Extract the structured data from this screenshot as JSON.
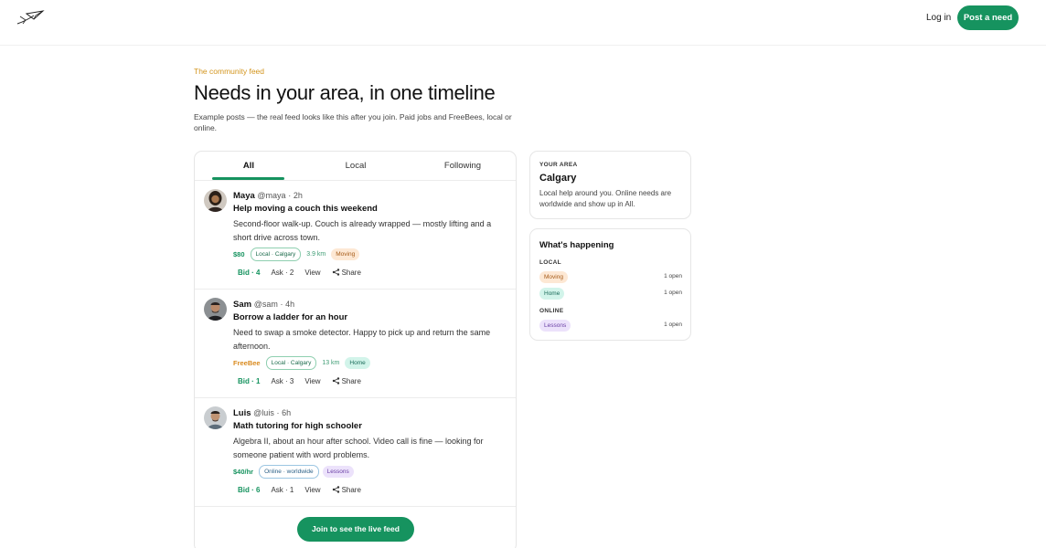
{
  "header": {
    "login_label": "Log in",
    "post_need_label": "Post a need",
    "accent": "#16935f"
  },
  "hero": {
    "eyebrow": "The community feed",
    "title": "Needs in your area, in one timeline",
    "intro": "Example posts — the real feed looks like this after you join. Paid jobs and FreeBees, local or online."
  },
  "feed": {
    "tabs": [
      {
        "label": "All",
        "active": true
      },
      {
        "label": "Local",
        "active": false
      },
      {
        "label": "Following",
        "active": false
      }
    ],
    "posts": [
      {
        "name": "Maya",
        "handle": "@maya",
        "time": "2h",
        "title": "Help moving a couch this weekend",
        "body": "Second-floor walk-up. Couch is already wrapped — mostly lifting and a short drive across town.",
        "price": "$80",
        "location": "Local · Calgary",
        "distance": "3.9 km",
        "category": "Moving",
        "bid": "Bid · 4",
        "ask": "Ask · 2",
        "view": "View",
        "share": "Share"
      },
      {
        "name": "Sam",
        "handle": "@sam",
        "time": "4h",
        "title": "Borrow a ladder for an hour",
        "body": "Need to swap a smoke detector. Happy to pick up and return the same afternoon.",
        "price": "FreeBee",
        "location": "Local · Calgary",
        "distance": "13 km",
        "category": "Home",
        "bid": "Bid · 1",
        "ask": "Ask · 3",
        "view": "View",
        "share": "Share"
      },
      {
        "name": "Luis",
        "handle": "@luis",
        "time": "6h",
        "title": "Math tutoring for high schooler",
        "body": "Algebra II, about an hour after school. Video call is fine — looking for someone patient with word problems.",
        "price": "$40/hr",
        "location": "Online · worldwide",
        "category": "Lessons",
        "bid": "Bid · 6",
        "ask": "Ask · 1",
        "view": "View",
        "share": "Share"
      }
    ],
    "join_label": "Join to see the live feed"
  },
  "sidebar": {
    "area": {
      "eyebrow": "YOUR AREA",
      "city": "Calgary",
      "description": "Local help around you. Online needs are worldwide and show up in All."
    },
    "happening": {
      "title": "What's happening",
      "local_label": "LOCAL",
      "online_label": "ONLINE",
      "local": [
        {
          "category": "Moving",
          "count": "1 open"
        },
        {
          "category": "Home",
          "count": "1 open"
        }
      ],
      "online": [
        {
          "category": "Lessons",
          "count": "1 open"
        }
      ]
    }
  }
}
